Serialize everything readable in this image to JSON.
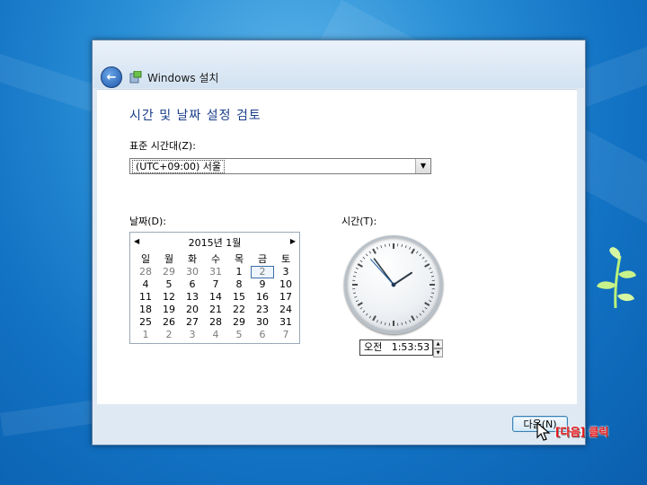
{
  "window": {
    "title": "Windows 설치",
    "heading": "시간 및 날짜 설정 검토"
  },
  "timezone": {
    "label": "표준 시간대(Z):",
    "value": "(UTC+09:00) 서울"
  },
  "date": {
    "label": "날짜(D):",
    "month_title": "2015년 1월",
    "weekdays": [
      "일",
      "월",
      "화",
      "수",
      "목",
      "금",
      "토"
    ],
    "weeks": [
      [
        "28",
        "29",
        "30",
        "31",
        "1",
        "2",
        "3"
      ],
      [
        "4",
        "5",
        "6",
        "7",
        "8",
        "9",
        "10"
      ],
      [
        "11",
        "12",
        "13",
        "14",
        "15",
        "16",
        "17"
      ],
      [
        "18",
        "19",
        "20",
        "21",
        "22",
        "23",
        "24"
      ],
      [
        "25",
        "26",
        "27",
        "28",
        "29",
        "30",
        "31"
      ],
      [
        "1",
        "2",
        "3",
        "4",
        "5",
        "6",
        "7"
      ]
    ],
    "selected_day": "2"
  },
  "time": {
    "label": "시간(T):",
    "value": "오전   1:53:53",
    "clock": {
      "hour": 1,
      "minute": 53,
      "second": 53
    }
  },
  "footer": {
    "next_button": "다음(N)"
  },
  "annotation": {
    "text": "[다음] 클릭"
  },
  "colors": {
    "heading": "#1a3e8a",
    "annotation": "#e8141b"
  }
}
